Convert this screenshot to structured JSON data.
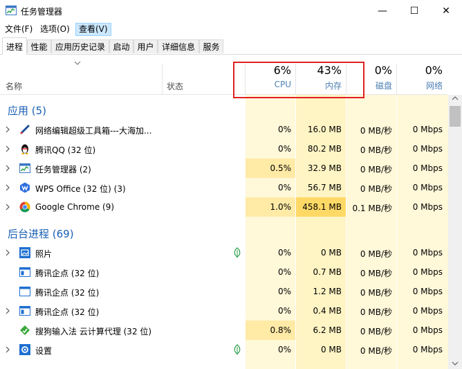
{
  "window": {
    "title": "任务管理器",
    "min_glyph": "—",
    "max_glyph": "☐",
    "close_glyph": "✕"
  },
  "menu": [
    "文件(F)",
    "选项(O)",
    "查看(V)"
  ],
  "tabs": [
    "进程",
    "性能",
    "应用历史记录",
    "启动",
    "用户",
    "详细信息",
    "服务"
  ],
  "columns": {
    "name": "名称",
    "status": "状态",
    "cpu": {
      "pct": "6%",
      "label": "CPU"
    },
    "memory": {
      "pct": "43%",
      "label": "内存"
    },
    "disk": {
      "pct": "0%",
      "label": "磁盘"
    },
    "network": {
      "pct": "0%",
      "label": "网络"
    }
  },
  "groups": {
    "apps": {
      "title": "应用 (5)"
    },
    "background": {
      "title": "后台进程 (69)"
    }
  },
  "apps": [
    {
      "name": "网络编辑超级工具箱---大海加...",
      "cpu": "0%",
      "mem": "16.0 MB",
      "disk": "0 MB/秒",
      "net": "0 Mbps",
      "icon": "pen-icon"
    },
    {
      "name": "腾讯QQ (32 位)",
      "cpu": "0%",
      "mem": "80.2 MB",
      "disk": "0 MB/秒",
      "net": "0 Mbps",
      "icon": "qq-penguin-icon"
    },
    {
      "name": "任务管理器 (2)",
      "cpu": "0.5%",
      "mem": "32.9 MB",
      "disk": "0 MB/秒",
      "net": "0 Mbps",
      "icon": "task-manager-icon"
    },
    {
      "name": "WPS Office (32 位) (3)",
      "cpu": "0%",
      "mem": "56.7 MB",
      "disk": "0 MB/秒",
      "net": "0 Mbps",
      "icon": "wps-icon"
    },
    {
      "name": "Google Chrome (9)",
      "cpu": "1.0%",
      "mem": "458.1 MB",
      "disk": "0.1 MB/秒",
      "net": "0 Mbps",
      "icon": "chrome-icon"
    }
  ],
  "background": [
    {
      "name": "照片",
      "cpu": "0%",
      "mem": "0 MB",
      "disk": "0 MB/秒",
      "net": "0 Mbps",
      "icon": "photos-icon"
    },
    {
      "name": "腾讯企点 (32 位)",
      "cpu": "0%",
      "mem": "0.7 MB",
      "disk": "0 MB/秒",
      "net": "0 Mbps",
      "icon": "window-app-icon"
    },
    {
      "name": "腾讯企点 (32 位)",
      "cpu": "0%",
      "mem": "1.2 MB",
      "disk": "0 MB/秒",
      "net": "0 Mbps",
      "icon": "window-app-icon"
    },
    {
      "name": "腾讯企点 (32 位)",
      "cpu": "0%",
      "mem": "0.4 MB",
      "disk": "0 MB/秒",
      "net": "0 Mbps",
      "icon": "window-app-icon"
    },
    {
      "name": "搜狗输入法 云计算代理 (32 位)",
      "cpu": "0.8%",
      "mem": "6.2 MB",
      "disk": "0 MB/秒",
      "net": "0 Mbps",
      "icon": "sogou-icon"
    },
    {
      "name": "设置",
      "cpu": "0%",
      "mem": "0 MB",
      "disk": "0 MB/秒",
      "net": "0 Mbps",
      "icon": "settings-gear-icon"
    }
  ],
  "colors": {
    "cpu_low": "#fff4c4",
    "cpu_mid": "#ffe9a8",
    "mem_low": "#ffefb0",
    "mem_high": "#ffd966",
    "disk": "#fff4c4",
    "net": "#fff4c4",
    "accent": "#1a5fb4",
    "highlight": "#e02020"
  }
}
